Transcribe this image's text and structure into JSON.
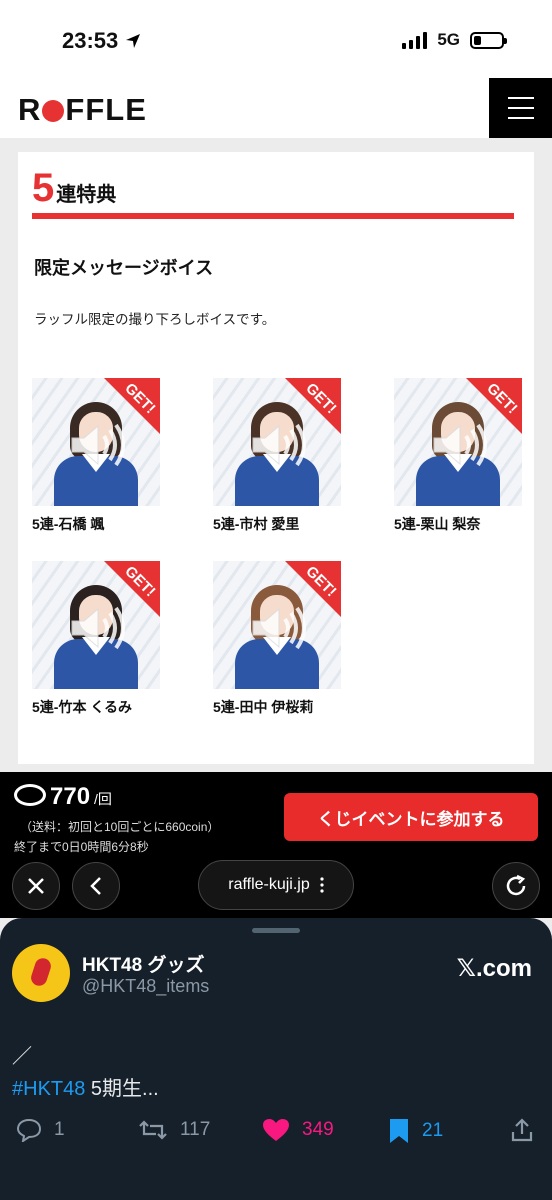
{
  "status": {
    "time": "23:53",
    "network": "5G"
  },
  "header": {
    "logo_pre": "R",
    "logo_post": "FFLE",
    "menu_icon": "hamburger-menu-icon"
  },
  "section": {
    "title_num": "5",
    "title_text": "連特典",
    "subtitle": "限定メッセージボイス",
    "description": "ラッフル限定の撮り下ろしボイスです。",
    "badge": "GET!",
    "voices": [
      {
        "name": "5連-石橋 颯"
      },
      {
        "name": "5連-市村 愛里"
      },
      {
        "name": "5連-栗山 梨奈"
      },
      {
        "name": "5連-竹本 くるみ"
      },
      {
        "name": "5連-田中 伊桜莉"
      }
    ]
  },
  "purchase": {
    "price": "770",
    "unit": "/回",
    "shipping": "（送料：初回と10回ごとに660coin）",
    "timer": "終了まで0日0時間6分8秒",
    "button": "くじイベントに参加する"
  },
  "browser": {
    "url": "raffle-kuji.jp"
  },
  "tweet_card": {
    "account": "HKT48 グッズ",
    "handle": "@HKT48_items",
    "source": "𝕏.com",
    "slash": "／",
    "hashtag": "#HKT48",
    "text": " 5期生...",
    "replies": "1",
    "retweets": "117",
    "likes": "349",
    "bookmarks": "21"
  },
  "colors": {
    "accent": "#e63232",
    "like": "#f91880",
    "link": "#1d9bf0"
  }
}
